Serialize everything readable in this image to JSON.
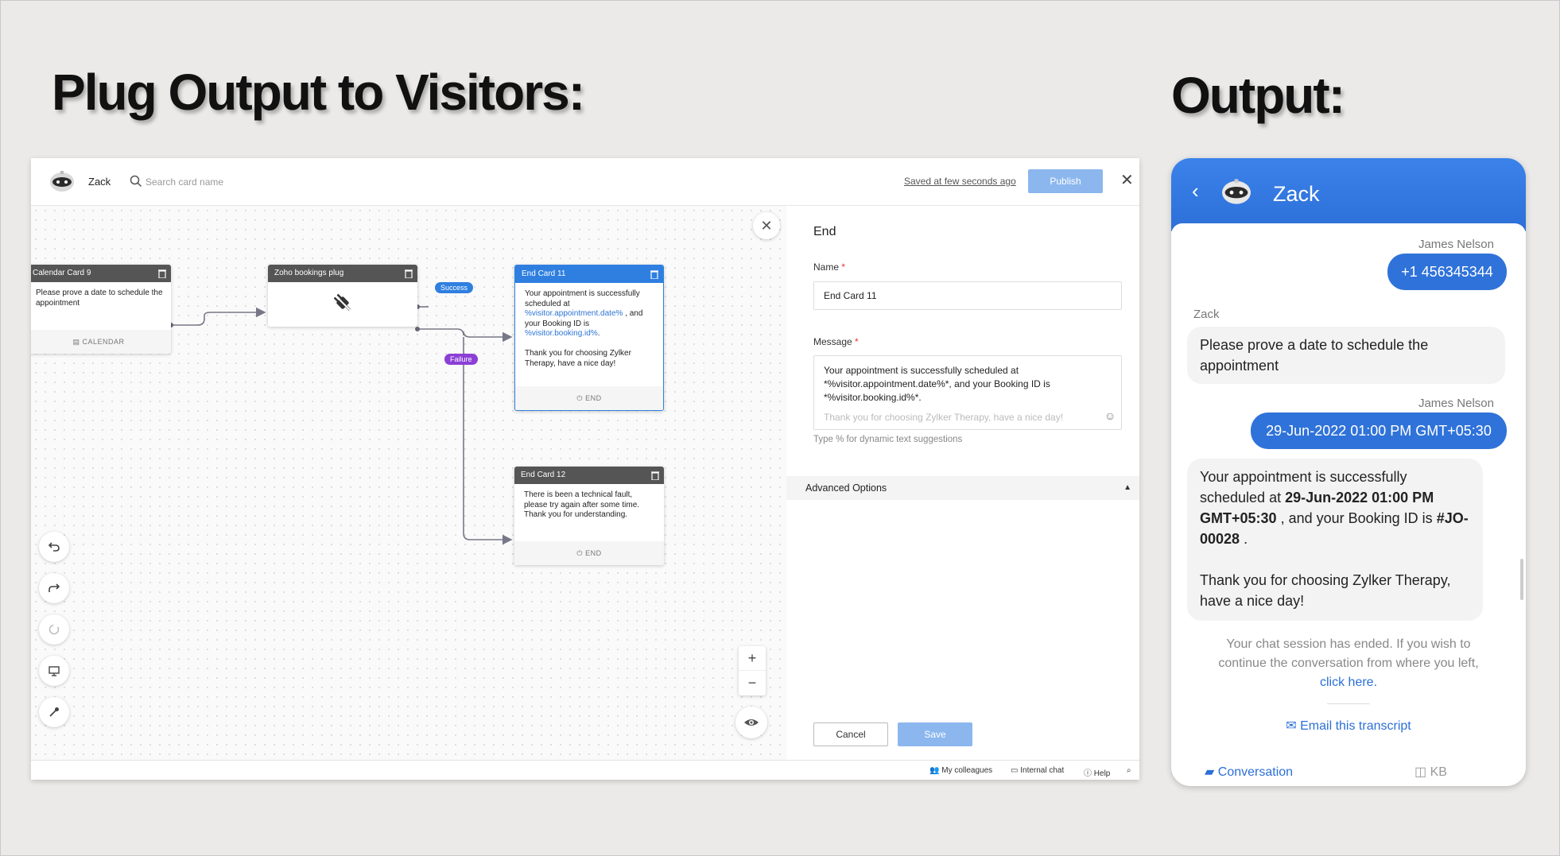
{
  "headings": {
    "left": "Plug Output to Visitors:",
    "right": "Output:"
  },
  "builder": {
    "bot_name": "Zack",
    "search_placeholder": "Search card name",
    "saved_text": "Saved at few seconds ago",
    "publish_label": "Publish",
    "cards": {
      "calendar": {
        "title": "Calendar Card 9",
        "text": "Please prove a date to schedule the appointment",
        "footer": "CALENDAR"
      },
      "plug": {
        "title": "Zoho bookings plug"
      },
      "end11": {
        "title": "End Card 11",
        "text_1": "Your appointment is successfully scheduled at",
        "var_1": "%visitor.appointment.date%",
        "text_2": ", and your Booking ID is",
        "var_2": "%visitor.booking.id%",
        "text_3": ".",
        "text_4": "Thank you for choosing Zylker Therapy, have a nice day!",
        "footer": "END"
      },
      "end12": {
        "title": "End Card 12",
        "text": "There is been a technical fault, please try again after some time. Thank you for understanding.",
        "footer": "END"
      }
    },
    "tags": {
      "success": "Success",
      "failure": "Failure"
    },
    "zoom": {
      "in": "+",
      "out": "−"
    },
    "panel": {
      "title": "End",
      "name_label": "Name",
      "name_value": "End Card 11",
      "message_label": "Message",
      "message_line_1": "Your appointment is successfully scheduled at",
      "message_line_2": "*%visitor.appointment.date%*, and your Booking ID is",
      "message_line_3": "*%visitor.booking.id%*.",
      "message_line_4": "Thank you for choosing Zylker Therapy, have a nice day!",
      "hint": "Type % for dynamic text suggestions",
      "advanced": "Advanced Options",
      "cancel": "Cancel",
      "save": "Save"
    },
    "statusbar": {
      "colleagues": "My colleagues",
      "internal_chat": "Internal chat",
      "help": "Help"
    }
  },
  "chat": {
    "title": "Zack",
    "msg1_sender": "James Nelson",
    "msg1_text": "+1 456345344",
    "msg2_sender": "Zack",
    "msg2_text": "Please prove a date to schedule the appointment",
    "msg3_sender": "James Nelson",
    "msg3_text": "29-Jun-2022 01:00 PM GMT+05:30",
    "msg4_text_1": "Your appointment is successfully scheduled at",
    "msg4_bold_1": "29-Jun-2022 01:00 PM GMT+05:30",
    "msg4_text_2": ", and your Booking ID is",
    "msg4_bold_2": "#JO-00028",
    "msg4_text_3": ".",
    "msg4_text_4": "Thank you for choosing Zylker Therapy, have a nice day!",
    "ended_text": "Your chat session has ended. If you wish to continue the conversation from where you left,",
    "ended_link": "click here.",
    "email_transcript": "Email this transcript",
    "tab_conversation": "Conversation",
    "tab_kb": "KB"
  },
  "colors": {
    "primary_blue": "#2f7fe0",
    "failure_purple": "#8b3fd6",
    "chat_blue": "#2f72d9",
    "button_disabled_blue": "#8bb7ee"
  }
}
